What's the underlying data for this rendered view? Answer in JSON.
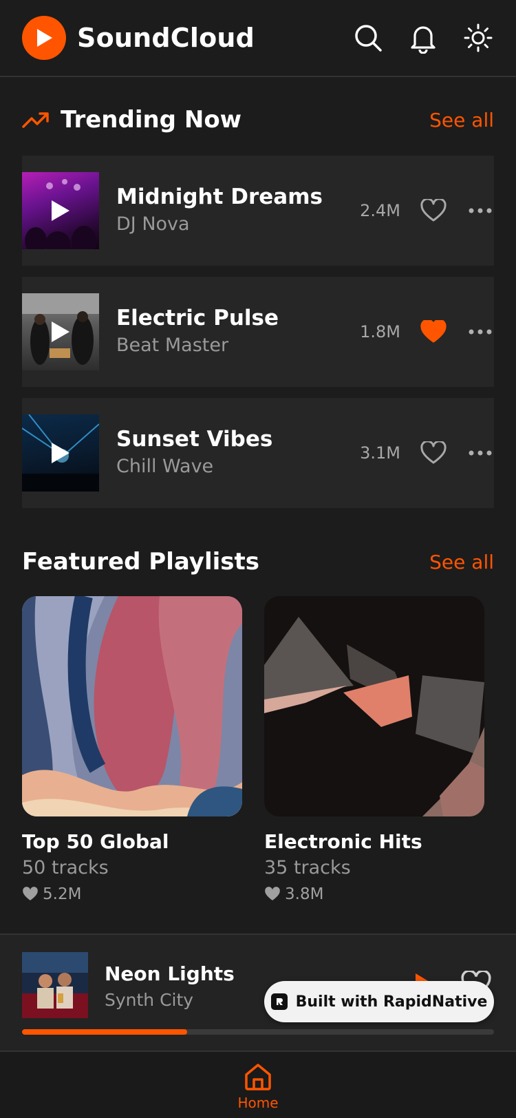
{
  "app": {
    "title": "SoundCloud"
  },
  "colors": {
    "accent": "#ff5500",
    "background": "#1c1c1c",
    "card": "#262626",
    "muted": "#9a9a9a"
  },
  "header": {
    "icons": [
      "play-logo-icon",
      "search-icon",
      "bell-icon",
      "sun-icon"
    ]
  },
  "trending": {
    "title": "Trending Now",
    "see_all": "See all",
    "tracks": [
      {
        "title": "Midnight Dreams",
        "artist": "DJ Nova",
        "plays": "2.4M",
        "liked": false
      },
      {
        "title": "Electric Pulse",
        "artist": "Beat Master",
        "plays": "1.8M",
        "liked": true
      },
      {
        "title": "Sunset Vibes",
        "artist": "Chill Wave",
        "plays": "3.1M",
        "liked": false
      }
    ]
  },
  "featured": {
    "title": "Featured Playlists",
    "see_all": "See all",
    "playlists": [
      {
        "title": "Top 50 Global",
        "count": "50 tracks",
        "likes": "5.2M"
      },
      {
        "title": "Electronic Hits",
        "count": "35 tracks",
        "likes": "3.8M"
      }
    ]
  },
  "now_playing": {
    "title": "Neon Lights",
    "artist": "Synth City",
    "progress": 0.35
  },
  "badge": {
    "label": "Built with RapidNative"
  },
  "nav": {
    "home_label": "Home"
  }
}
